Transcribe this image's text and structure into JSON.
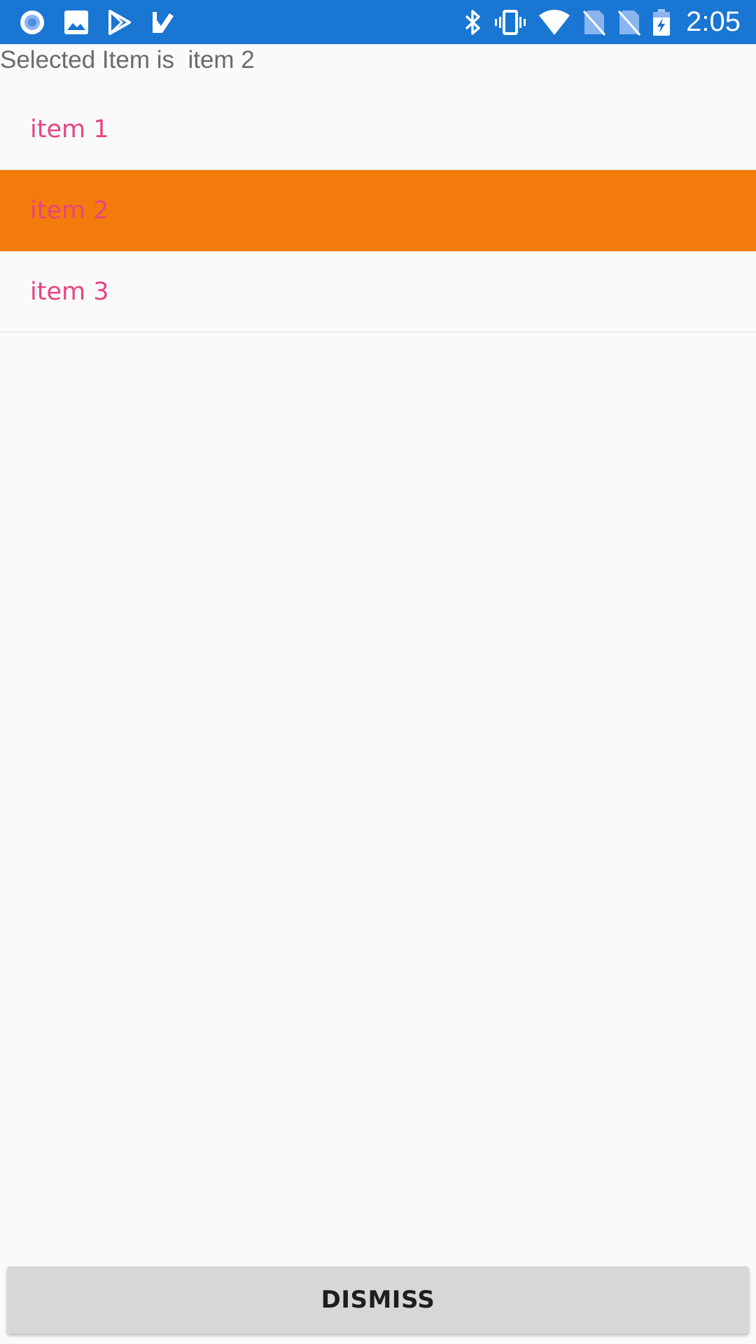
{
  "status_bar": {
    "time": "2:05",
    "background_color": "#1976D2",
    "notification_icons": [
      "record-icon",
      "image-icon",
      "play-store-icon",
      "tasks-icon"
    ],
    "system_icons": [
      "bluetooth-icon",
      "vibrate-icon",
      "wifi-icon",
      "no-sim-icon",
      "no-sim-icon",
      "battery-charging-icon"
    ]
  },
  "selected_text": "Selected Item is  item 2",
  "list": {
    "items": [
      {
        "label": "item 1",
        "selected": false
      },
      {
        "label": "item 2",
        "selected": true
      },
      {
        "label": "item 3",
        "selected": false
      }
    ],
    "selected_color": "#F27B0B",
    "text_color": "#E8457F"
  },
  "dismiss_button": {
    "label": "DISMISS"
  }
}
